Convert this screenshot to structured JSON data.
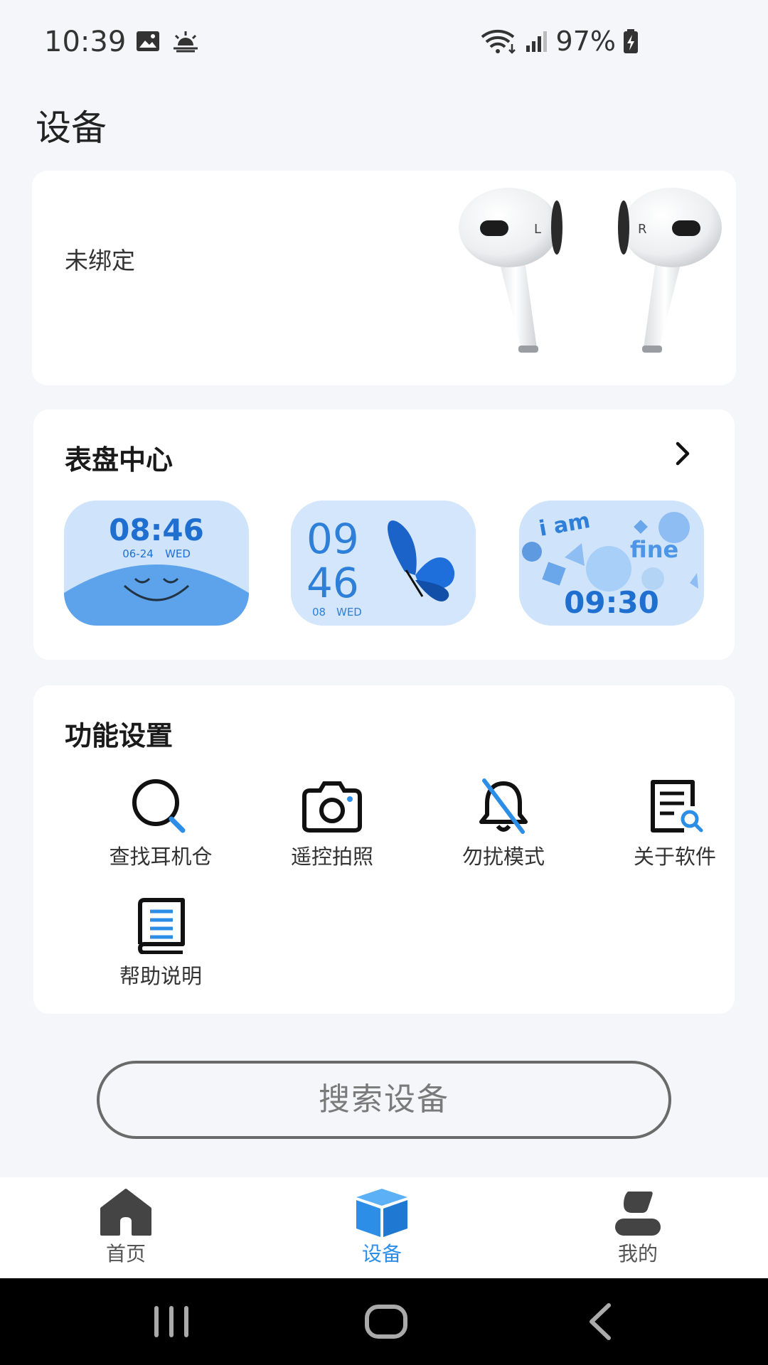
{
  "status_bar": {
    "time": "10:39",
    "battery": "97%",
    "left_icons": [
      "image-icon",
      "weather-sunrise-icon"
    ],
    "right_icons": [
      "wifi-icon",
      "signal-icon",
      "battery-charging-icon"
    ]
  },
  "page": {
    "title": "设备"
  },
  "device_card": {
    "status": "未绑定",
    "image": "earbuds-image"
  },
  "watch_faces": {
    "title": "表盘中心",
    "faces": [
      {
        "time": "08:46",
        "date": "06-24",
        "weekday": "WED"
      },
      {
        "hour": "09",
        "minute": "46",
        "date": "08",
        "weekday": "WED"
      },
      {
        "text_top": "i am",
        "text_mid": "fine",
        "time": "09:30"
      }
    ]
  },
  "functions": {
    "title": "功能设置",
    "items": [
      {
        "label": "查找耳机仓",
        "icon": "search-icon"
      },
      {
        "label": "遥控拍照",
        "icon": "camera-icon"
      },
      {
        "label": "勿扰模式",
        "icon": "bell-off-icon"
      },
      {
        "label": "关于软件",
        "icon": "document-search-icon"
      },
      {
        "label": "帮助说明",
        "icon": "help-book-icon"
      }
    ]
  },
  "search_button": {
    "label": "搜索设备"
  },
  "bottom_nav": {
    "items": [
      {
        "label": "首页",
        "icon": "home-icon"
      },
      {
        "label": "设备",
        "icon": "cube-icon",
        "active": true
      },
      {
        "label": "我的",
        "icon": "user-icon"
      }
    ]
  },
  "colors": {
    "accent": "#2d8ee8",
    "background": "#f4f6f9",
    "card": "#ffffff",
    "face_bg": "#cfe3fb"
  }
}
